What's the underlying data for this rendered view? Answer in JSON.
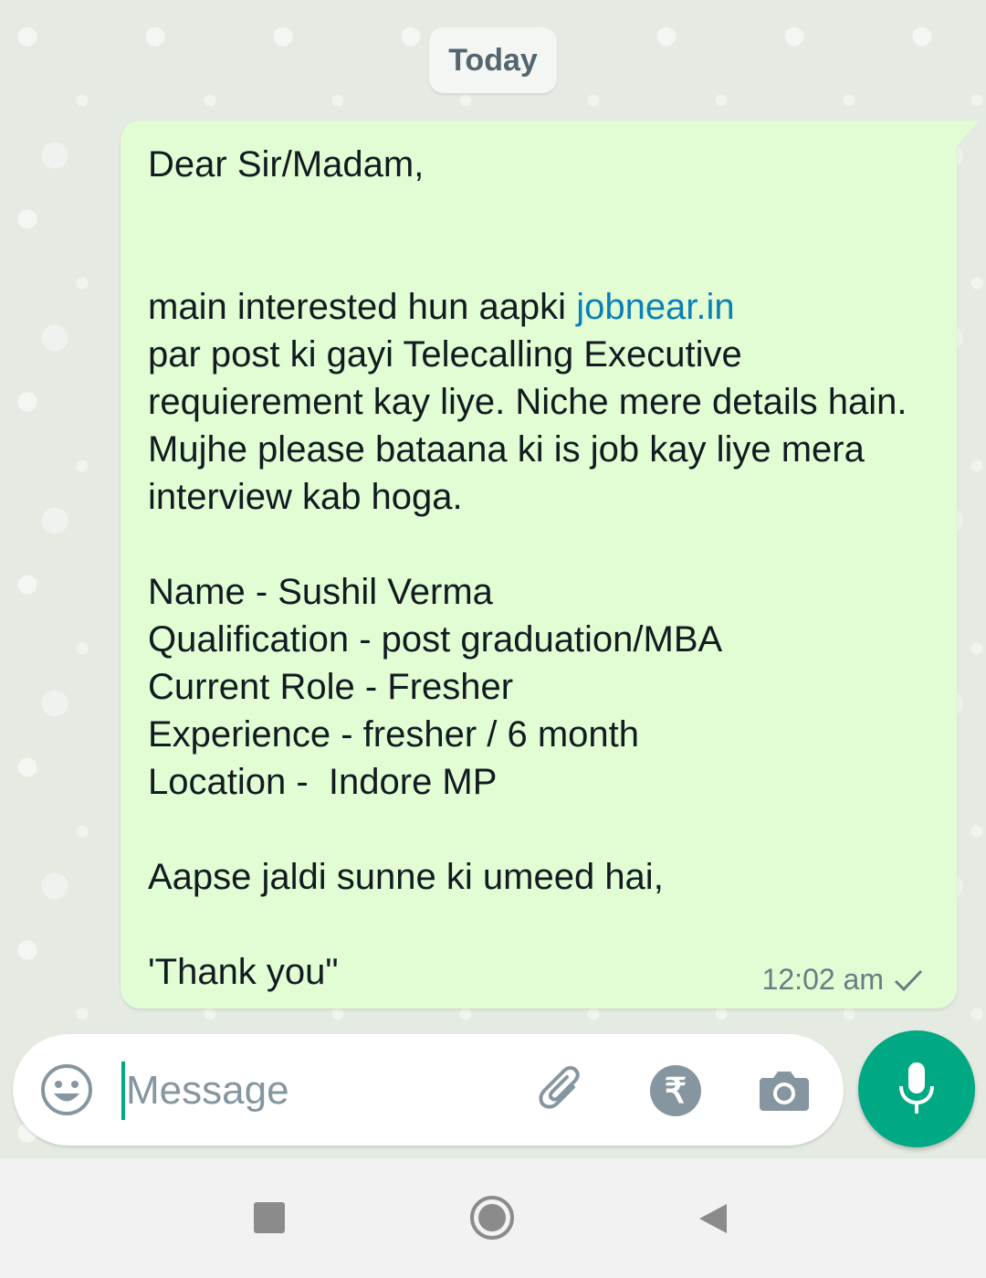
{
  "chat": {
    "date_label": "Today"
  },
  "message": {
    "greeting": "Dear Sir/Madam,",
    "intro_prefix": "main interested hun aapki ",
    "link_text": "jobnear.in",
    "intro_rest": "par post ki gayi Telecalling Executive requierement kay liye. Niche mere details hain. Mujhe please bataana ki is job kay liye mera interview kab hoga.",
    "details": [
      "Name - Sushil Verma",
      "Qualification - post graduation/MBA",
      "Current Role - Fresher",
      "Experience - fresher / 6 month",
      "Location -  Indore MP"
    ],
    "closing": "Aapse jaldi sunne ki umeed hai,",
    "signoff": "'Thank you\"",
    "time": "12:02 am",
    "status": "sent"
  },
  "composer": {
    "placeholder": "Message"
  },
  "colors": {
    "accent": "#00a884",
    "bubble": "#e2fdd3",
    "link": "#0b7fb8"
  },
  "icons": [
    "emoji-icon",
    "attach-icon",
    "rupee-icon",
    "camera-icon",
    "mic-icon",
    "check-icon",
    "nav-recents-icon",
    "nav-home-icon",
    "nav-back-icon"
  ]
}
